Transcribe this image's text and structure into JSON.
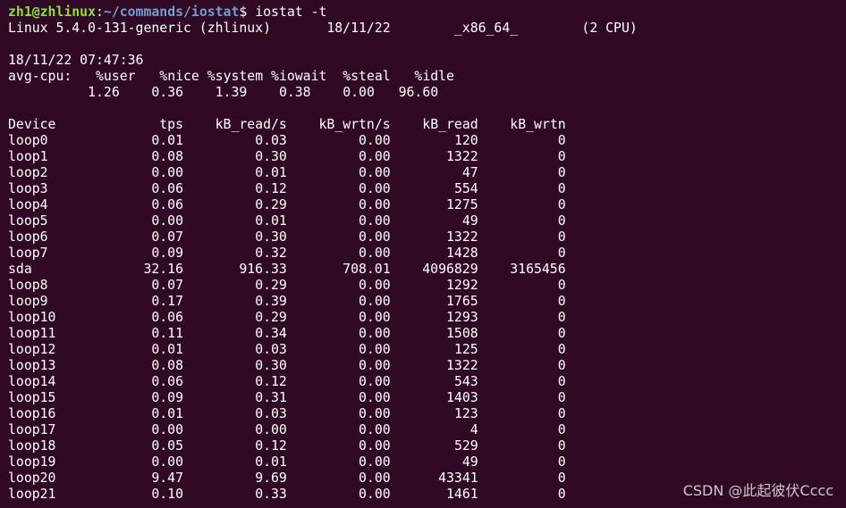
{
  "prompt": {
    "user_host": "zh1@zhlinux",
    "colon": ":",
    "path": "~/commands/iostat",
    "symbol": "$",
    "command": " iostat -t"
  },
  "system_line": "Linux 5.4.0-131-generic (zhlinux)       18/11/22        _x86_64_        (2 CPU)",
  "timestamp": "18/11/22 07:47:36",
  "cpu": {
    "label": "avg-cpu:",
    "headers": [
      "%user",
      "%nice",
      "%system",
      "%iowait",
      "%steal",
      "%idle"
    ],
    "values": [
      "1.26",
      "0.36",
      "1.39",
      "0.38",
      "0.00",
      "96.60"
    ]
  },
  "device_table": {
    "headers": [
      "Device",
      "tps",
      "kB_read/s",
      "kB_wrtn/s",
      "kB_read",
      "kB_wrtn"
    ],
    "rows": [
      [
        "loop0",
        "0.01",
        "0.03",
        "0.00",
        "120",
        "0"
      ],
      [
        "loop1",
        "0.08",
        "0.30",
        "0.00",
        "1322",
        "0"
      ],
      [
        "loop2",
        "0.00",
        "0.01",
        "0.00",
        "47",
        "0"
      ],
      [
        "loop3",
        "0.06",
        "0.12",
        "0.00",
        "554",
        "0"
      ],
      [
        "loop4",
        "0.06",
        "0.29",
        "0.00",
        "1275",
        "0"
      ],
      [
        "loop5",
        "0.00",
        "0.01",
        "0.00",
        "49",
        "0"
      ],
      [
        "loop6",
        "0.07",
        "0.30",
        "0.00",
        "1322",
        "0"
      ],
      [
        "loop7",
        "0.09",
        "0.32",
        "0.00",
        "1428",
        "0"
      ],
      [
        "sda",
        "32.16",
        "916.33",
        "708.01",
        "4096829",
        "3165456"
      ],
      [
        "loop8",
        "0.07",
        "0.29",
        "0.00",
        "1292",
        "0"
      ],
      [
        "loop9",
        "0.17",
        "0.39",
        "0.00",
        "1765",
        "0"
      ],
      [
        "loop10",
        "0.06",
        "0.29",
        "0.00",
        "1293",
        "0"
      ],
      [
        "loop11",
        "0.11",
        "0.34",
        "0.00",
        "1508",
        "0"
      ],
      [
        "loop12",
        "0.01",
        "0.03",
        "0.00",
        "125",
        "0"
      ],
      [
        "loop13",
        "0.08",
        "0.30",
        "0.00",
        "1322",
        "0"
      ],
      [
        "loop14",
        "0.06",
        "0.12",
        "0.00",
        "543",
        "0"
      ],
      [
        "loop15",
        "0.09",
        "0.31",
        "0.00",
        "1403",
        "0"
      ],
      [
        "loop16",
        "0.01",
        "0.03",
        "0.00",
        "123",
        "0"
      ],
      [
        "loop17",
        "0.00",
        "0.00",
        "0.00",
        "4",
        "0"
      ],
      [
        "loop18",
        "0.05",
        "0.12",
        "0.00",
        "529",
        "0"
      ],
      [
        "loop19",
        "0.00",
        "0.01",
        "0.00",
        "49",
        "0"
      ],
      [
        "loop20",
        "9.47",
        "9.69",
        "0.00",
        "43341",
        "0"
      ],
      [
        "loop21",
        "0.10",
        "0.33",
        "0.00",
        "1461",
        "0"
      ]
    ]
  },
  "watermark": "CSDN @此起彼伏Cccc",
  "colors": {
    "background": "#300a24",
    "prompt_user": "#8ae234",
    "prompt_path": "#729fcf",
    "text": "#ffffff"
  }
}
